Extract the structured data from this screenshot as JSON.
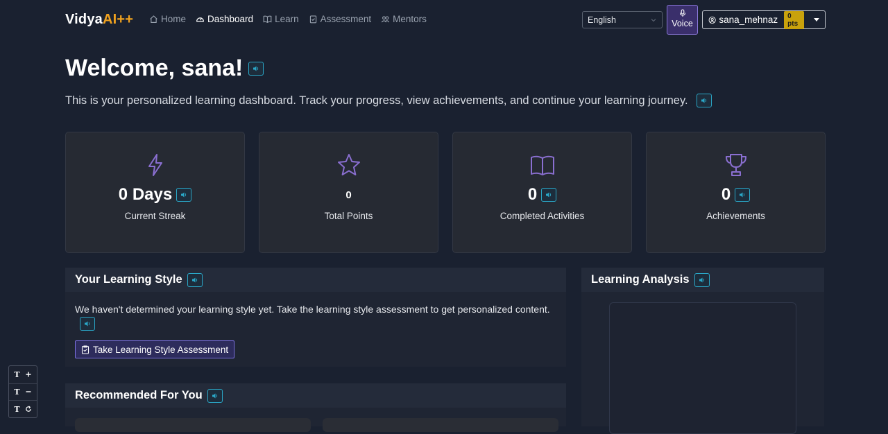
{
  "brand": {
    "part1": "Vidya",
    "part2": "AI++"
  },
  "nav": {
    "home": "Home",
    "dashboard": "Dashboard",
    "learn": "Learn",
    "assessment": "Assessment",
    "mentors": "Mentors"
  },
  "language": {
    "selected": "English"
  },
  "voice": {
    "label": "Voice"
  },
  "user": {
    "name": "sana_mehnaz",
    "points": "0 pts"
  },
  "header": {
    "welcome": "Welcome, sana!",
    "subtitle": "This is your personalized learning dashboard. Track your progress, view achievements, and continue your learning journey."
  },
  "stats": {
    "streak": {
      "value": "0 Days",
      "label": "Current Streak"
    },
    "points": {
      "value": "0",
      "label": "Total Points"
    },
    "activities": {
      "value": "0",
      "label": "Completed Activities"
    },
    "achievements": {
      "value": "0",
      "label": "Achievements"
    }
  },
  "learning_style": {
    "title": "Your Learning Style",
    "text": "We haven't determined your learning style yet. Take the learning style assessment to get personalized content.",
    "button": "Take Learning Style Assessment"
  },
  "learning_analysis": {
    "title": "Learning Analysis"
  },
  "recommended": {
    "title": "Recommended For You"
  },
  "font_tool": {
    "increase": "T",
    "decrease": "T",
    "reset": "T"
  },
  "colors": {
    "background": "#1a2130",
    "accent_purple": "#8a6fd1",
    "brand_orange": "#f0a21f",
    "speaker_cyan": "#2aa7c7",
    "points_badge": "#c9a20c"
  },
  "icons": {
    "streak": "lightning-icon",
    "points": "star-icon",
    "activities": "book-icon",
    "achievements": "trophy-icon",
    "speaker": "speaker-icon"
  }
}
